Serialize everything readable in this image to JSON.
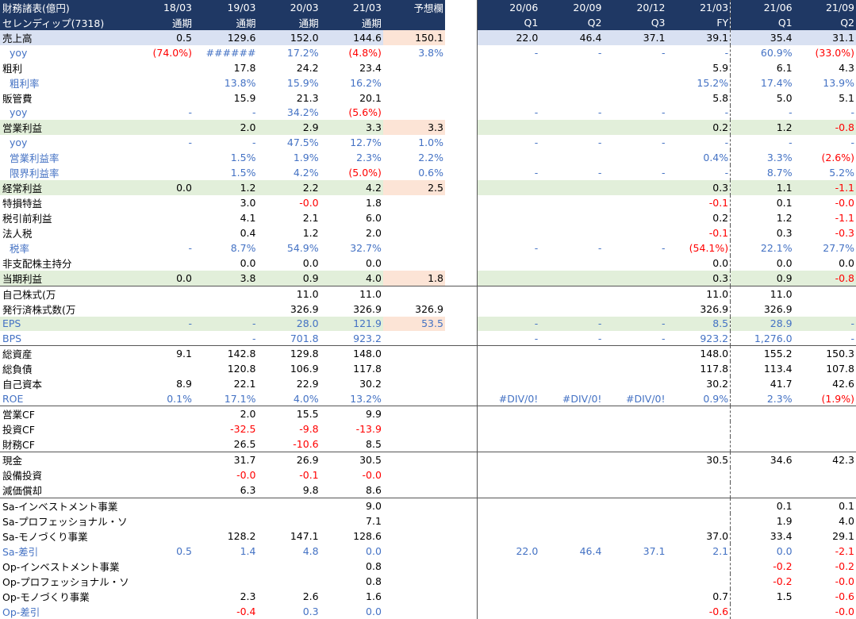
{
  "colors": {
    "header_bg": "#1f3864",
    "blue": "#4472c4",
    "red": "#ff0000",
    "row_blue": "#d9e1f2",
    "row_green": "#e2efda",
    "forecast_pink": "#fce4d6"
  },
  "header": {
    "row1": [
      "財務諸表(億円)",
      "18/03",
      "19/03",
      "20/03",
      "21/03",
      "予想欄",
      "",
      "20/06",
      "20/09",
      "20/12",
      "21/03",
      "21/06",
      "21/09"
    ],
    "row2": [
      "セレンディップ(7318)",
      "通期",
      "通期",
      "通期",
      "通期",
      "",
      "",
      "Q1",
      "Q2",
      "Q3",
      "FY",
      "Q1",
      "Q2"
    ]
  },
  "rows": [
    {
      "label": "売上高",
      "bg": "blue",
      "cells": [
        "0.5",
        "129.6",
        "152.0",
        "144.6",
        "150.1",
        "",
        "22.0",
        "46.4",
        "37.1",
        "39.1",
        "35.4",
        "31.1"
      ]
    },
    {
      "label": "yoy",
      "style": "blue",
      "indent": true,
      "cells": [
        "(74.0%)",
        "######",
        "17.2%",
        "(4.8%)",
        "3.8%",
        "",
        "-",
        "-",
        "-",
        "-",
        "60.9%",
        "(33.0%)"
      ],
      "red": [
        0,
        3,
        11
      ]
    },
    {
      "label": "粗利",
      "cells": [
        "",
        "17.8",
        "24.2",
        "23.4",
        "",
        "",
        "",
        "",
        "",
        "5.9",
        "6.1",
        "4.3"
      ]
    },
    {
      "label": "粗利率",
      "style": "blue",
      "indent": true,
      "cells": [
        "",
        "13.8%",
        "15.9%",
        "16.2%",
        "",
        "",
        "",
        "",
        "",
        "15.2%",
        "17.4%",
        "13.9%"
      ]
    },
    {
      "label": "販管費",
      "cells": [
        "",
        "15.9",
        "21.3",
        "20.1",
        "",
        "",
        "",
        "",
        "",
        "5.8",
        "5.0",
        "5.1"
      ]
    },
    {
      "label": "yoy",
      "style": "blue",
      "indent": true,
      "cells": [
        "-",
        "-",
        "34.2%",
        "(5.6%)",
        "",
        "",
        "-",
        "-",
        "-",
        "-",
        "-",
        "-"
      ],
      "red": [
        3
      ]
    },
    {
      "label": "営業利益",
      "bg": "green",
      "cells": [
        "",
        "2.0",
        "2.9",
        "3.3",
        "3.3",
        "",
        "",
        "",
        "",
        "0.2",
        "1.2",
        "-0.8"
      ],
      "red": [
        11
      ]
    },
    {
      "label": "yoy",
      "style": "blue",
      "indent": true,
      "cells": [
        "-",
        "-",
        "47.5%",
        "12.7%",
        "1.0%",
        "",
        "-",
        "-",
        "-",
        "-",
        "-",
        "-"
      ]
    },
    {
      "label": "営業利益率",
      "style": "blue",
      "indent": true,
      "cells": [
        "",
        "1.5%",
        "1.9%",
        "2.3%",
        "2.2%",
        "",
        "",
        "",
        "",
        "0.4%",
        "3.3%",
        "(2.6%)"
      ],
      "red": [
        11
      ]
    },
    {
      "label": "限界利益率",
      "style": "blue",
      "indent": true,
      "cells": [
        "",
        "1.5%",
        "4.2%",
        "(5.0%)",
        "0.6%",
        "",
        "-",
        "-",
        "-",
        "-",
        "8.7%",
        "5.2%"
      ],
      "red": [
        3
      ]
    },
    {
      "label": "経常利益",
      "bg": "green",
      "cells": [
        "0.0",
        "1.2",
        "2.2",
        "4.2",
        "2.5",
        "",
        "",
        "",
        "",
        "0.3",
        "1.1",
        "-1.1"
      ],
      "red": [
        11
      ]
    },
    {
      "label": "特損特益",
      "cells": [
        "",
        "3.0",
        "-0.0",
        "1.8",
        "",
        "",
        "",
        "",
        "",
        "-0.1",
        "0.1",
        "-0.0"
      ],
      "red": [
        2,
        9,
        11
      ]
    },
    {
      "label": "税引前利益",
      "cells": [
        "",
        "4.1",
        "2.1",
        "6.0",
        "",
        "",
        "",
        "",
        "",
        "0.2",
        "1.2",
        "-1.1"
      ],
      "red": [
        11
      ]
    },
    {
      "label": "法人税",
      "cells": [
        "",
        "0.4",
        "1.2",
        "2.0",
        "",
        "",
        "",
        "",
        "",
        "-0.1",
        "0.3",
        "-0.3"
      ],
      "red": [
        9,
        11
      ]
    },
    {
      "label": "税率",
      "style": "blue",
      "indent": true,
      "cells": [
        "-",
        "8.7%",
        "54.9%",
        "32.7%",
        "",
        "",
        "-",
        "-",
        "-",
        "(54.1%)",
        "22.1%",
        "27.7%"
      ],
      "red": [
        9
      ]
    },
    {
      "label": "非支配株主持分",
      "cells": [
        "",
        "0.0",
        "0.0",
        "0.0",
        "",
        "",
        "",
        "",
        "",
        "0.0",
        "0.0",
        "0.0"
      ]
    },
    {
      "label": "当期利益",
      "bg": "green",
      "cells": [
        "0.0",
        "3.8",
        "0.9",
        "4.0",
        "1.8",
        "",
        "",
        "",
        "",
        "0.3",
        "0.9",
        "-0.8"
      ],
      "red": [
        11
      ]
    },
    {
      "label": "自己株式(万",
      "sep": true,
      "cells": [
        "",
        "",
        "11.0",
        "11.0",
        "",
        "",
        "",
        "",
        "",
        "11.0",
        "11.0",
        ""
      ]
    },
    {
      "label": "発行済株式数(万",
      "cells": [
        "",
        "",
        "326.9",
        "326.9",
        "326.9",
        "",
        "",
        "",
        "",
        "326.9",
        "326.9",
        ""
      ]
    },
    {
      "label": "EPS",
      "style": "blue",
      "bg": "green",
      "cells": [
        "-",
        "-",
        "28.0",
        "121.9",
        "53.5",
        "",
        "-",
        "-",
        "-",
        "8.5",
        "28.9",
        "-"
      ]
    },
    {
      "label": "BPS",
      "style": "blue",
      "cells": [
        "",
        "-",
        "701.8",
        "923.2",
        "",
        "",
        "-",
        "-",
        "-",
        "923.2",
        "1,276.0",
        "-"
      ]
    },
    {
      "label": "総資産",
      "sep": true,
      "cells": [
        "9.1",
        "142.8",
        "129.8",
        "148.0",
        "",
        "",
        "",
        "",
        "",
        "148.0",
        "155.2",
        "150.3"
      ]
    },
    {
      "label": "総負債",
      "cells": [
        "",
        "120.8",
        "106.9",
        "117.8",
        "",
        "",
        "",
        "",
        "",
        "117.8",
        "113.4",
        "107.8"
      ]
    },
    {
      "label": "自己資本",
      "cells": [
        "8.9",
        "22.1",
        "22.9",
        "30.2",
        "",
        "",
        "",
        "",
        "",
        "30.2",
        "41.7",
        "42.6"
      ]
    },
    {
      "label": "ROE",
      "style": "blue",
      "cells": [
        "0.1%",
        "17.1%",
        "4.0%",
        "13.2%",
        "",
        "",
        "#DIV/0!",
        "#DIV/0!",
        "#DIV/0!",
        "0.9%",
        "2.3%",
        "(1.9%)"
      ],
      "red": [
        11
      ]
    },
    {
      "label": "営業CF",
      "sep": true,
      "cells": [
        "",
        "2.0",
        "15.5",
        "9.9",
        "",
        "",
        "",
        "",
        "",
        "",
        "",
        ""
      ]
    },
    {
      "label": "投資CF",
      "cells": [
        "",
        "-32.5",
        "-9.8",
        "-13.9",
        "",
        "",
        "",
        "",
        "",
        "",
        "",
        ""
      ],
      "red": [
        1,
        2,
        3
      ]
    },
    {
      "label": "財務CF",
      "cells": [
        "",
        "26.5",
        "-10.6",
        "8.5",
        "",
        "",
        "",
        "",
        "",
        "",
        "",
        ""
      ],
      "red": [
        2
      ]
    },
    {
      "label": "現金",
      "sep": true,
      "cells": [
        "",
        "31.7",
        "26.9",
        "30.5",
        "",
        "",
        "",
        "",
        "",
        "30.5",
        "34.6",
        "42.3"
      ]
    },
    {
      "label": "設備投資",
      "cells": [
        "",
        "-0.0",
        "-0.1",
        "-0.0",
        "",
        "",
        "",
        "",
        "",
        "",
        "",
        ""
      ],
      "red": [
        1,
        2,
        3
      ]
    },
    {
      "label": "減価償却",
      "cells": [
        "",
        "6.3",
        "9.8",
        "8.6",
        "",
        "",
        "",
        "",
        "",
        "",
        "",
        ""
      ]
    },
    {
      "label": "Sa-インベストメント事業",
      "sep": true,
      "cells": [
        "",
        "",
        "",
        "9.0",
        "",
        "",
        "",
        "",
        "",
        "",
        "0.1",
        "0.1"
      ]
    },
    {
      "label": "Sa-プロフェッショナル・ソ",
      "cells": [
        "",
        "",
        "",
        "7.1",
        "",
        "",
        "",
        "",
        "",
        "",
        "1.9",
        "4.0"
      ]
    },
    {
      "label": "Sa-モノづくり事業",
      "cells": [
        "",
        "128.2",
        "147.1",
        "128.6",
        "",
        "",
        "",
        "",
        "",
        "37.0",
        "33.4",
        "29.1"
      ]
    },
    {
      "label": "Sa-差引",
      "style": "blue",
      "cells": [
        "0.5",
        "1.4",
        "4.8",
        "0.0",
        "",
        "",
        "22.0",
        "46.4",
        "37.1",
        "2.1",
        "0.0",
        "-2.1"
      ],
      "red": [
        11
      ]
    },
    {
      "label": "Op-インベストメント事業",
      "cells": [
        "",
        "",
        "",
        "0.8",
        "",
        "",
        "",
        "",
        "",
        "",
        "-0.2",
        "-0.2"
      ],
      "red": [
        10,
        11
      ]
    },
    {
      "label": "Op-プロフェッショナル・ソ",
      "cells": [
        "",
        "",
        "",
        "0.8",
        "",
        "",
        "",
        "",
        "",
        "",
        "-0.2",
        "-0.0"
      ],
      "red": [
        10,
        11
      ]
    },
    {
      "label": "Op-モノづくり事業",
      "cells": [
        "",
        "2.3",
        "2.6",
        "1.6",
        "",
        "",
        "",
        "",
        "",
        "0.7",
        "1.5",
        "-0.6"
      ],
      "red": [
        11
      ]
    },
    {
      "label": "Op-差引",
      "style": "blue",
      "cells": [
        "",
        "-0.4",
        "0.3",
        "0.0",
        "",
        "",
        "",
        "",
        "",
        "-0.6",
        "",
        "-0.0"
      ],
      "red": [
        1,
        9,
        11
      ]
    }
  ]
}
